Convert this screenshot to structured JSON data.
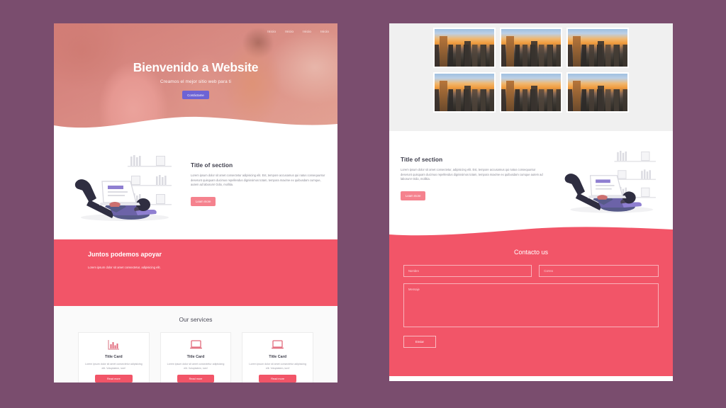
{
  "canvas": {
    "background_color": "#7a4d6e"
  },
  "theme": {
    "pink": "#f25568",
    "soft_pink": "#f5828e",
    "purple_button": "#6d63d4",
    "gallery_bg": "#f0f0f0",
    "services_bg": "#fafafa"
  },
  "left_page": {
    "hero": {
      "nav": [
        {
          "label": "Inicio"
        },
        {
          "label": "Inicio"
        },
        {
          "label": "Inicio"
        },
        {
          "label": "Inicio"
        }
      ],
      "title": "Bienvenido a Website",
      "subtitle": "Creamos el mejor sitio web para ti",
      "button_label": "Contáctame"
    },
    "section": {
      "title": "Title of section",
      "body": "Lorem ipsum dolor sit amet consectetur adipisicing elit. Est, tempore accusamus qui natus consequuntur deserunt quisquam ducimus repellendus dignissimos totam, tempora maxime ex quibusdam cumque, autem ad laborum! Odio, mollitia.",
      "button_label": "Learn more"
    },
    "cta": {
      "title": "Juntos podemos apoyar",
      "subtitle": "Lorem ipsum dolor sit amet consectetur, adipisicing elit."
    },
    "services": {
      "title": "Our services",
      "cards": [
        {
          "icon": "bar-chart-icon",
          "title": "Title Card",
          "body": "Lorem ipsum dolor sit amet consectetur adipisicing elit. Voluptatem, iure!",
          "button_label": "Read more"
        },
        {
          "icon": "laptop-icon",
          "title": "Title Card",
          "body": "Lorem ipsum dolor sit amet consectetur adipisicing elit. Voluptatem, iure!",
          "button_label": "Read more"
        },
        {
          "icon": "laptop-icon",
          "title": "Title Card",
          "body": "Lorem ipsum dolor sit amet consectetur adipisicing elit. Voluptatem, iure!",
          "button_label": "Read more"
        }
      ]
    }
  },
  "right_page": {
    "gallery": {
      "image_alt": "city-sunset-skyline",
      "count": 6
    },
    "section": {
      "title": "Title of section",
      "body": "Lorem ipsum dolor sit amet consectetur, adipisicing elit. Est, tempore accusamus qui natus consequuntur deserunt quisquam ducimus repellendus dignissimos totam, tempora maxime ex quibusdam cumque autem ad laborum! Odio, mollitia.",
      "button_label": "Learn more"
    },
    "contact": {
      "title": "Contacto us",
      "name_placeholder": "Nombre",
      "email_placeholder": "Correo",
      "message_placeholder": "Mensaje",
      "submit_label": "Enviar"
    }
  }
}
